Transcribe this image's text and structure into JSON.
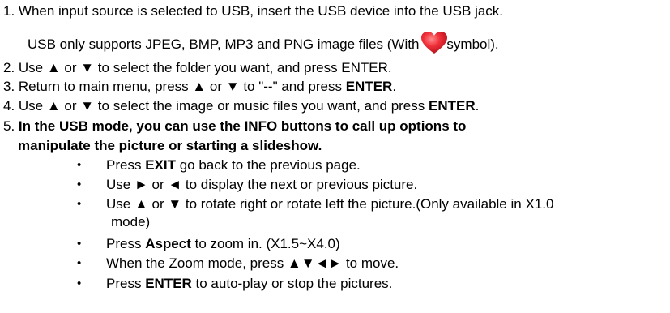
{
  "doc": {
    "item1": "1. When input source is selected to USB, insert the USB device into the USB jack.",
    "item1_note_pre": "USB only supports JPEG, BMP, MP3 and PNG image files (With",
    "item1_note_post": "symbol).",
    "item2": "2. Use ▲ or ▼ to select the folder you want, and press ENTER.",
    "item3_pre": "3. Return to main menu, press ▲ or ▼ to \"--\" and press ",
    "item3_bold": "ENTER",
    "item3_post": ".",
    "item4_pre": "4. Use ▲ or ▼ to select the image or music files you want, and press ",
    "item4_bold": "ENTER",
    "item4_post": ".",
    "item5_num": "5. ",
    "item5_line1": "In the USB mode, you can use the INFO buttons to call up options to",
    "item5_line2": "manipulate the picture or starting a slideshow.",
    "bullet_char": "•",
    "bullets": [
      {
        "pre": "Press ",
        "bold": "EXIT",
        "post": " go back to the previous page."
      },
      {
        "pre": "Use ► or ◄ to display the next or previous picture.",
        "bold": "",
        "post": ""
      },
      {
        "pre": "Use ▲ or ▼ to rotate right or rotate left the picture.(Only available in X1.0",
        "bold": "",
        "post": ""
      },
      {
        "pre": "Press ",
        "bold": "Aspect",
        "post": " to zoom in. (X1.5~X4.0)"
      },
      {
        "pre": "When the Zoom mode, press ▲▼◄► to move.",
        "bold": "",
        "post": ""
      },
      {
        "pre": "Press ",
        "bold": "ENTER",
        "post": " to auto-play or stop the pictures."
      }
    ],
    "bullet3_cont": "mode)",
    "heart_icon": "heart-icon",
    "heart_color": "#e8262e"
  }
}
